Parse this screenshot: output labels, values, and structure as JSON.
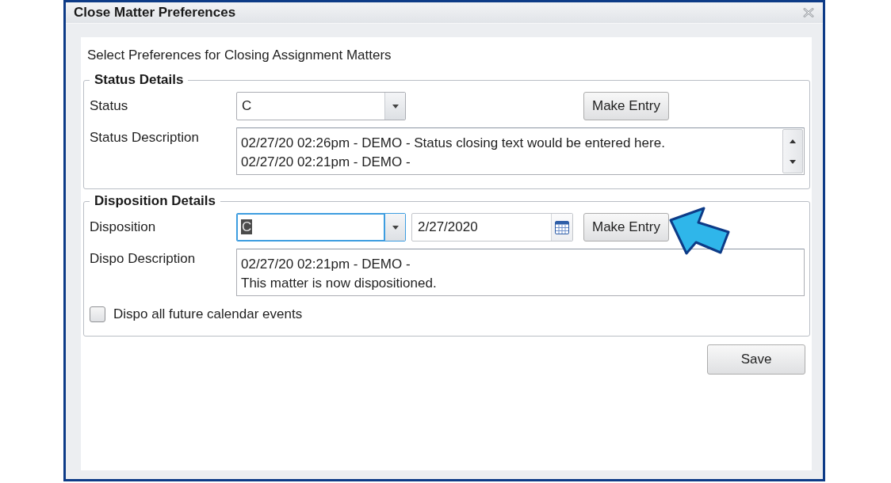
{
  "window": {
    "title": "Close Matter Preferences"
  },
  "instructions": "Select Preferences for Closing Assignment Matters",
  "status_details": {
    "title": "Status Details",
    "status": {
      "label": "Status",
      "value": "C",
      "focused": false
    },
    "make_entry_button": {
      "label": "Make Entry"
    },
    "description": {
      "label": "Status Description",
      "lines": [
        "02/27/20 02:26pm - DEMO - Status closing text would be entered here.",
        "02/27/20 02:21pm - DEMO -"
      ],
      "scrollbar": true
    }
  },
  "disposition_details": {
    "title": "Disposition Details",
    "disposition": {
      "label": "Disposition",
      "value": "C",
      "focused": true
    },
    "date": {
      "value": "2/27/2020"
    },
    "make_entry_button": {
      "label": "Make Entry"
    },
    "description": {
      "label": "Dispo Description",
      "lines": [
        "02/27/20 02:21pm - DEMO -",
        "This matter is now dispositioned."
      ],
      "scrollbar": false
    },
    "future_events_checkbox": {
      "label": "Dispo all future calendar events",
      "checked": false
    }
  },
  "save_button": {
    "label": "Save"
  }
}
